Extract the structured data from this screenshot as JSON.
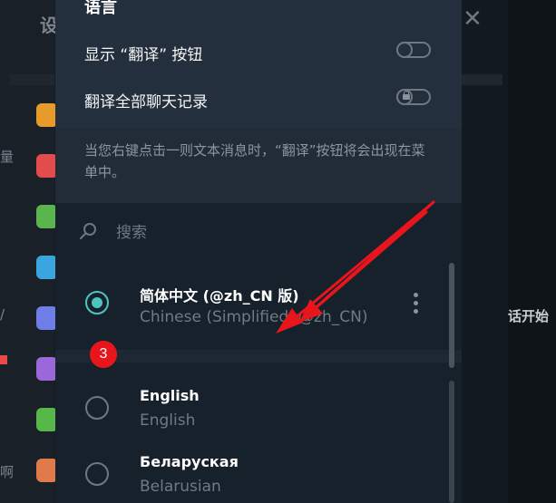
{
  "background": {
    "title_char": "设",
    "left_chars": [
      "量",
      "/",
      "啊"
    ],
    "right_chat_text": "话开始"
  },
  "modal": {
    "section_title": "语言",
    "show_translate_label": "显示 “翻译” 按钮",
    "translate_all_label": "翻译全部聊天记录",
    "info_text": "当您右键点击一则文本消息时，“翻译”按钮将会出现在菜单中。",
    "search_placeholder": "搜索",
    "languages": [
      {
        "name": "简体中文 (@zh_CN 版)",
        "subtitle": "Chinese (Simplified, @zh_CN)",
        "selected": true
      },
      {
        "name": "English",
        "subtitle": "English",
        "selected": false
      },
      {
        "name": "Беларуская",
        "subtitle": "Belarusian",
        "selected": false
      }
    ]
  },
  "annotation": {
    "badge_number": "3",
    "arrow_color": "#e8161c"
  },
  "colors": {
    "accent": "#4ac5c1",
    "modal_bg": "#17212b",
    "header_bg": "#242f3d"
  }
}
